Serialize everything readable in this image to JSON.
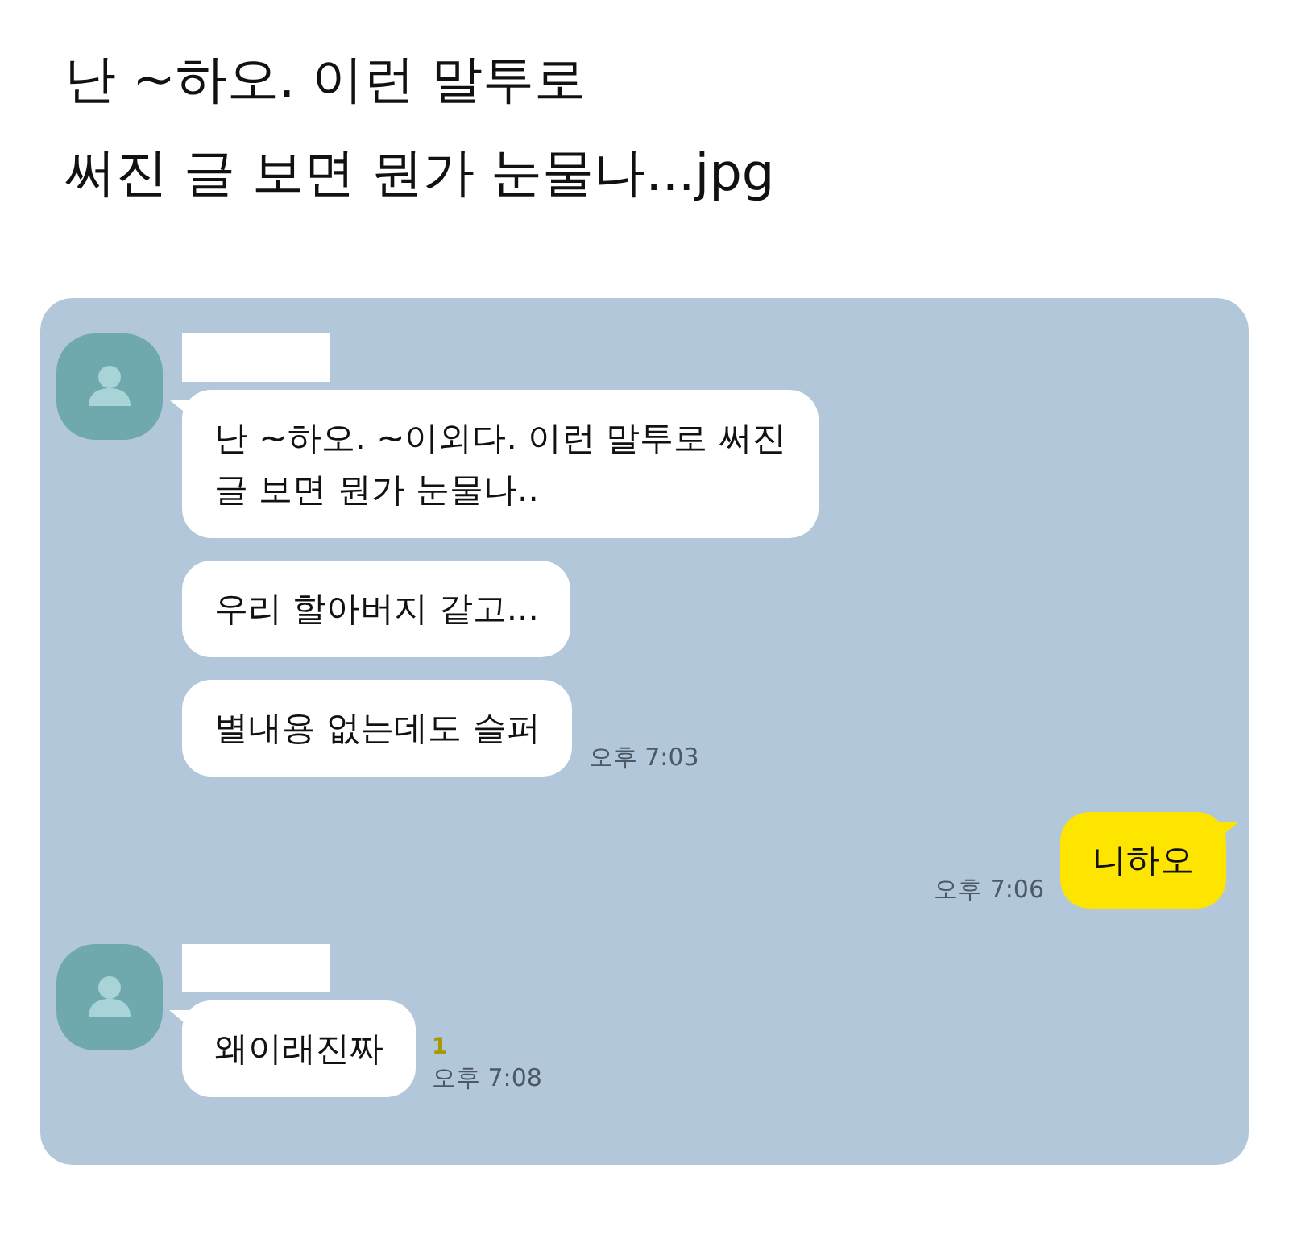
{
  "title_lines": [
    "난 ~하오. 이런 말투로",
    "써진 글 보면 뭔가 눈물나...jpg"
  ],
  "chat": {
    "messages": [
      {
        "kind": "received",
        "bubbles": [
          "난 ~하오. ~이외다. 이런 말투로 써진\n글 보면 뭔가 눈물나..",
          "우리 할아버지 같고...",
          "별내용 없는데도 슬퍼"
        ],
        "time": "오후 7:03"
      },
      {
        "kind": "sent",
        "bubbles": [
          "니하오"
        ],
        "time": "오후 7:06"
      },
      {
        "kind": "received",
        "bubbles": [
          "왜이래진짜"
        ],
        "unread": "1",
        "time": "오후 7:08"
      }
    ]
  }
}
